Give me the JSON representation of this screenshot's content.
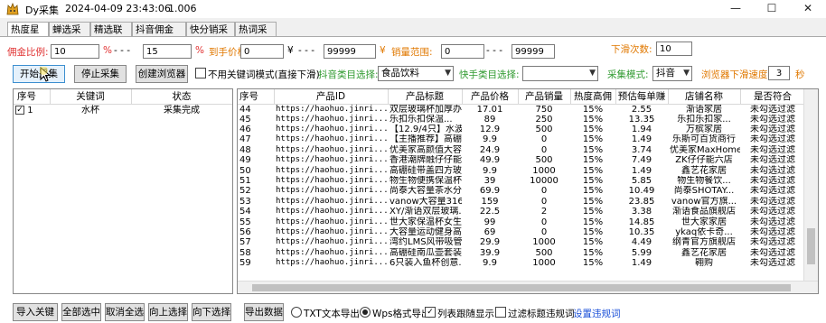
{
  "window": {
    "title": "Dy采集",
    "datetime": "2024-04-09 23:43:06",
    "version": "1.006"
  },
  "tabs": [
    "热度星选",
    "蝉选采集",
    "精选联盟",
    "抖音佣金采集",
    "快分销采集",
    "热词采集"
  ],
  "filters": {
    "commission_label": "佣金比例:",
    "commission_min": "10",
    "commission_max": "15",
    "percent": "%",
    "price_label": "到手价格:",
    "price_min": "0",
    "price_max": "99999",
    "yen": "¥",
    "sales_label": "销量范围:",
    "sales_min": "0",
    "sales_max": "99999",
    "scroll_count_label": "下滑次数:",
    "scroll_count": "10",
    "dash": "- - -"
  },
  "toolbar": {
    "start": "开始采集",
    "stop": "停止采集",
    "create_browser": "创建浏览器",
    "no_keyword_mode": "不用关键词模式(直接下滑)",
    "douyin_category_label": "抖音类目选择:",
    "douyin_category": "食品饮料",
    "kuaishou_category_label": "快手类目选择:",
    "kuaishou_category": "",
    "collect_mode_label": "采集模式:",
    "collect_mode": "抖音",
    "scroll_speed_label": "浏览器下滑速度:",
    "scroll_speed": "3",
    "seconds": "秒"
  },
  "keywords": {
    "headers": [
      "序号",
      "关键词",
      "状态"
    ],
    "rows": [
      {
        "index": "1",
        "keyword": "水杯",
        "status": "采集完成"
      }
    ]
  },
  "products": {
    "headers": [
      "序号",
      "产品ID",
      "产品标题",
      "产品价格",
      "产品销量",
      "热度高佣",
      "预估每单赚",
      "店铺名称",
      "是否符合"
    ],
    "rows": [
      [
        "44",
        "https://haohuo.jinri...",
        "双层玻璃杯加厚办...",
        "17.01",
        "750",
        "15%",
        "2.55",
        "渐语家居",
        "未勾选过滤"
      ],
      [
        "45",
        "https://haohuo.jinri...",
        "乐扣乐扣保温...",
        "89",
        "250",
        "15%",
        "13.35",
        "乐扣乐扣家...",
        "未勾选过滤"
      ],
      [
        "46",
        "https://haohuo.jinri...",
        "【12.9/4只】水波...",
        "12.9",
        "500",
        "15%",
        "1.94",
        "万槟家居",
        "未勾选过滤"
      ],
      [
        "47",
        "https://haohuo.jinri...",
        "【主播推荐】高硼...",
        "9.9",
        "0",
        "15%",
        "1.49",
        "乐斯可百货商行",
        "未勾选过滤"
      ],
      [
        "48",
        "https://haohuo.jinri...",
        "优美家高颜值大容...",
        "24.9",
        "0",
        "15%",
        "3.74",
        "优美家MaxHome",
        "未勾选过滤"
      ],
      [
        "49",
        "https://haohuo.jinri...",
        "香港潮牌融仔仔能...",
        "49.9",
        "500",
        "15%",
        "7.49",
        "ZK仔仔能六店",
        "未勾选过滤"
      ],
      [
        "50",
        "https://haohuo.jinri...",
        "高硼硅带盖四方玻...",
        "9.9",
        "1000",
        "15%",
        "1.49",
        "鑫艺花家居",
        "未勾选过滤"
      ],
      [
        "51",
        "https://haohuo.jinri...",
        "物生物便携保温杯...",
        "39",
        "10000",
        "15%",
        "5.85",
        "物生物餐饮...",
        "未勾选过滤"
      ],
      [
        "52",
        "https://haohuo.jinri...",
        "尚泰大容量茶水分...",
        "69.9",
        "0",
        "15%",
        "10.49",
        "尚泰SHOTAY...",
        "未勾选过滤"
      ],
      [
        "53",
        "https://haohuo.jinri...",
        "vanow大容量316不...",
        "159",
        "0",
        "15%",
        "23.85",
        "vanow官方旗...",
        "未勾选过滤"
      ],
      [
        "54",
        "https://haohuo.jinri...",
        "XY/渐语双层玻璃...",
        "22.5",
        "2",
        "15%",
        "3.38",
        "渐语食品旗舰店",
        "未勾选过滤"
      ],
      [
        "55",
        "https://haohuo.jinri...",
        "世大家保温杯女生...",
        "99",
        "0",
        "15%",
        "14.85",
        "世大家家居",
        "未勾选过滤"
      ],
      [
        "56",
        "https://haohuo.jinri...",
        "大容量运动健身高...",
        "69",
        "0",
        "15%",
        "10.35",
        "ykaq依卡奇...",
        "未勾选过滤"
      ],
      [
        "57",
        "https://haohuo.jinri...",
        "湾约LMS风带吸管...",
        "29.9",
        "1000",
        "15%",
        "4.49",
        "纲青官方旗舰店",
        "未勾选过滤"
      ],
      [
        "58",
        "https://haohuo.jinri...",
        "高硼硅南瓜壶套装...",
        "39.9",
        "500",
        "15%",
        "5.99",
        "鑫艺花家居",
        "未勾选过滤"
      ],
      [
        "59",
        "https://haohuo.jinri...",
        "6只装入鱼杯创意...",
        "9.9",
        "1000",
        "15%",
        "1.49",
        "翱购",
        "未勾选过滤"
      ]
    ]
  },
  "bottom_left": {
    "import": "导入关键词",
    "select_all": "全部选中",
    "deselect_all": "取消全选",
    "move_up": "向上选择",
    "move_down": "向下选择"
  },
  "bottom_right": {
    "export": "导出数据",
    "txt_export": "TXT文本导出",
    "wps_export": "Wps格式导出",
    "follow_display": "列表跟随显示",
    "filter_violations": "过滤标题违规词",
    "set_violations": "设置违规词"
  },
  "colors": {
    "label_red": "#e03030",
    "label_orange": "#e07800",
    "label_green": "#2f9a2f",
    "link": "#1a4fd8"
  }
}
